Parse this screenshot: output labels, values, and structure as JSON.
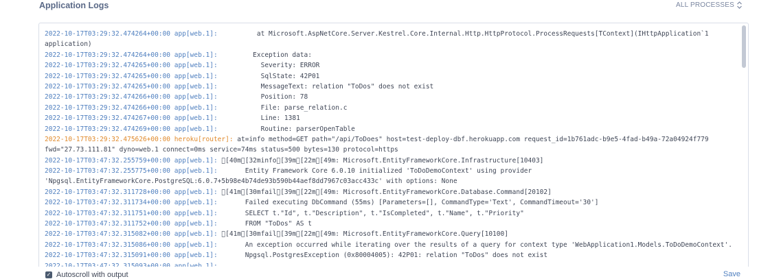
{
  "header": {
    "title": "Application Logs",
    "process_filter_label": "ALL PROCESSES"
  },
  "logs": [
    {
      "ts": "2022-10-17T03:29:32.474264+00:00",
      "src": "app[web.1]:",
      "msg": "          at Microsoft.AspNetCore.Server.Kestrel.Core.Internal.Http.HttpProtocol.ProcessRequests[TContext](IHttpApplication`1"
    },
    {
      "ts": "",
      "src": "",
      "msg": "application)"
    },
    {
      "ts": "2022-10-17T03:29:32.474264+00:00",
      "src": "app[web.1]:",
      "msg": "         Exception data:"
    },
    {
      "ts": "2022-10-17T03:29:32.474265+00:00",
      "src": "app[web.1]:",
      "msg": "           Severity: ERROR"
    },
    {
      "ts": "2022-10-17T03:29:32.474265+00:00",
      "src": "app[web.1]:",
      "msg": "           SqlState: 42P01"
    },
    {
      "ts": "2022-10-17T03:29:32.474265+00:00",
      "src": "app[web.1]:",
      "msg": "           MessageText: relation \"ToDos\" does not exist"
    },
    {
      "ts": "2022-10-17T03:29:32.474266+00:00",
      "src": "app[web.1]:",
      "msg": "           Position: 78"
    },
    {
      "ts": "2022-10-17T03:29:32.474266+00:00",
      "src": "app[web.1]:",
      "msg": "           File: parse_relation.c"
    },
    {
      "ts": "2022-10-17T03:29:32.474267+00:00",
      "src": "app[web.1]:",
      "msg": "           Line: 1381"
    },
    {
      "ts": "2022-10-17T03:29:32.474269+00:00",
      "src": "app[web.1]:",
      "msg": "           Routine: parserOpenTable"
    },
    {
      "ts": "2022-10-17T03:29:32.475626+00:00",
      "src": "heroku[router]:",
      "msg": " at=info method=GET path=\"/api/ToDoes\" host=test-deploy-dbf.herokuapp.com request_id=1b761adc-b9e5-4fad-b49a-72a04924f779",
      "router": true
    },
    {
      "ts": "",
      "src": "",
      "msg": "fwd=\"27.73.111.81\" dyno=web.1 connect=0ms service=74ms status=500 bytes=130 protocol=https"
    },
    {
      "ts": "2022-10-17T03:47:32.255759+00:00",
      "src": "app[web.1]:",
      "msg": " \u0000[40m\u0000[32minfo\u0000[39m\u0000[22m\u0000[49m: Microsoft.EntityFrameworkCore.Infrastructure[10403]"
    },
    {
      "ts": "2022-10-17T03:47:32.255775+00:00",
      "src": "app[web.1]:",
      "msg": "       Entity Framework Core 6.0.10 initialized 'ToDoDemoContext' using provider"
    },
    {
      "ts": "",
      "src": "",
      "msg": "'Npgsql.EntityFrameworkCore.PostgreSQL:6.0.7+5b98e4b74de93b590b44aef8dd7967c03acc433c' with options: None"
    },
    {
      "ts": "2022-10-17T03:47:32.311728+00:00",
      "src": "app[web.1]:",
      "msg": " \u0000[41m\u0000[30mfail\u0000[39m\u0000[22m\u0000[49m: Microsoft.EntityFrameworkCore.Database.Command[20102]"
    },
    {
      "ts": "2022-10-17T03:47:32.311734+00:00",
      "src": "app[web.1]:",
      "msg": "       Failed executing DbCommand (55ms) [Parameters=[], CommandType='Text', CommandTimeout='30']"
    },
    {
      "ts": "2022-10-17T03:47:32.311751+00:00",
      "src": "app[web.1]:",
      "msg": "       SELECT t.\"Id\", t.\"Description\", t.\"IsCompleted\", t.\"Name\", t.\"Priority\""
    },
    {
      "ts": "2022-10-17T03:47:32.311752+00:00",
      "src": "app[web.1]:",
      "msg": "       FROM \"ToDos\" AS t"
    },
    {
      "ts": "2022-10-17T03:47:32.315082+00:00",
      "src": "app[web.1]:",
      "msg": " \u0000[41m\u0000[30mfail\u0000[39m\u0000[22m\u0000[49m: Microsoft.EntityFrameworkCore.Query[10100]"
    },
    {
      "ts": "2022-10-17T03:47:32.315086+00:00",
      "src": "app[web.1]:",
      "msg": "       An exception occurred while iterating over the results of a query for context type 'WebApplication1.Models.ToDoDemoContext'."
    },
    {
      "ts": "2022-10-17T03:47:32.315091+00:00",
      "src": "app[web.1]:",
      "msg": "       Npgsql.PostgresException (0x80004005): 42P01: relation \"ToDos\" does not exist"
    },
    {
      "ts": "2022-10-17T03:47:32.315093+00:00",
      "src": "app[web.1]:",
      "msg": ""
    }
  ],
  "footer": {
    "autoscroll_label": "Autoscroll with output",
    "autoscroll_checked": true,
    "save_label": "Save"
  },
  "colors": {
    "timestamp": "#4f7fbf",
    "router": "#e08a2c",
    "text": "#3f4656",
    "title": "#5a6987"
  },
  "icons": {
    "process_filter": "chevron-up-down-icon",
    "autoscroll": "checkbox-checked-icon"
  }
}
